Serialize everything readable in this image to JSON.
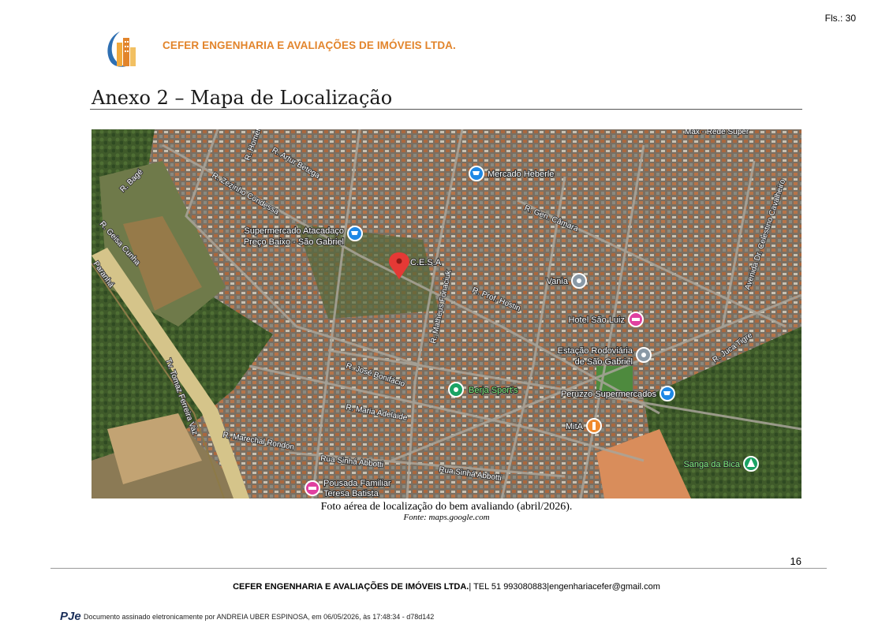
{
  "header": {
    "page_ref": "Fls.: 30",
    "company": "CEFER ENGENHARIA E AVALIAÇÕES DE IMÓVEIS LTDA.",
    "title": "Anexo 2 – Mapa de Localização"
  },
  "map": {
    "streets": {
      "bage": "R. Bagé",
      "homero": "R. Homero",
      "artur_betega": "R. Artur Betega",
      "zezinho": "R. Zezinho Condessa",
      "geisa": "R. Geisa Cunha",
      "gen_camara": "R. Gen. Câmara",
      "prof_hostin": "R. Prof. Hostin",
      "matheus": "R. Matheus Fonaciuk",
      "jose_bonifacio": "R. José Bonifácio",
      "maria_adelaide": "R. Maria Adelaide",
      "marechal": "R. Marechal Rondon",
      "sinha1": "Rua Sinhá Abbotti",
      "sinha2": "Rua Sinhá Abbotti",
      "juca_tigre": "R. Juca Tigre",
      "celestino": "Avenida Dr. Celestino Cavalheiro",
      "ferreira": "Tv. Tomaz Ferreira Vaz",
      "rodovia": "Paranhá",
      "max": "Max - Rede Super"
    },
    "places": {
      "mercado": "Mercado Heberle",
      "super1": "Supermercado Atacadaço",
      "super2": "Preço Baixo - São Gabriel",
      "cesa": "C.E.S.A",
      "vania": "Vania",
      "hotel": "Hotel São Luiz",
      "rodov1": "Estação Rodoviária",
      "rodov2": "de São Gabriel",
      "berja": "Berja Sport's",
      "peruzzo": "Peruzzo Supermercados",
      "mita": "MitA",
      "sanga": "Sanga da Bica",
      "pousada1": "Pousada Familiar",
      "pousada2": "Teresa Batista"
    }
  },
  "caption": "Foto aérea de localização do bem avaliando (abril/2026).",
  "source": "Fonte: maps.google.com",
  "page_number": "16",
  "footer": {
    "company": "CEFER ENGENHARIA E AVALIAÇÕES DE IMÓVEIS LTDA.",
    "contact": "| TEL 51 993080883|engenhariacefer@gmail.com"
  },
  "signature": {
    "logo_text": "PJe",
    "text": "Documento assinado eletronicamente por ANDREIA UBER ESPINOSA, em 06/05/2026, às 17:48:34 - d78d142"
  }
}
